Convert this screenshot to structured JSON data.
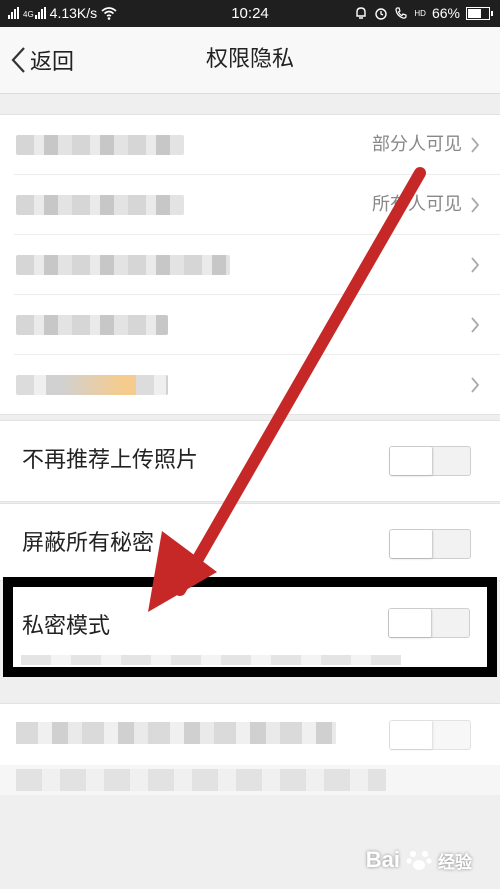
{
  "status": {
    "speed": "4.13K/s",
    "time": "10:24",
    "battery": "66%",
    "net1": "4G",
    "net2": "HD"
  },
  "nav": {
    "back_label": "返回",
    "title": "权限隐私"
  },
  "list_values": [
    "部分人可见",
    "所有人可见"
  ],
  "toggles": {
    "no_recommend": "不再推荐上传照片",
    "hide_secrets": "屏蔽所有秘密",
    "private_mode": "私密模式"
  },
  "icons": [
    "chevron-left-icon",
    "chevron-right-icon",
    "wifi-icon",
    "alarm-icon",
    "call-icon",
    "battery-icon"
  ],
  "colors": {
    "arrow": "#c62828",
    "frame": "#000000"
  },
  "watermark": {
    "brand": "Bai",
    "suffix": "经验"
  }
}
